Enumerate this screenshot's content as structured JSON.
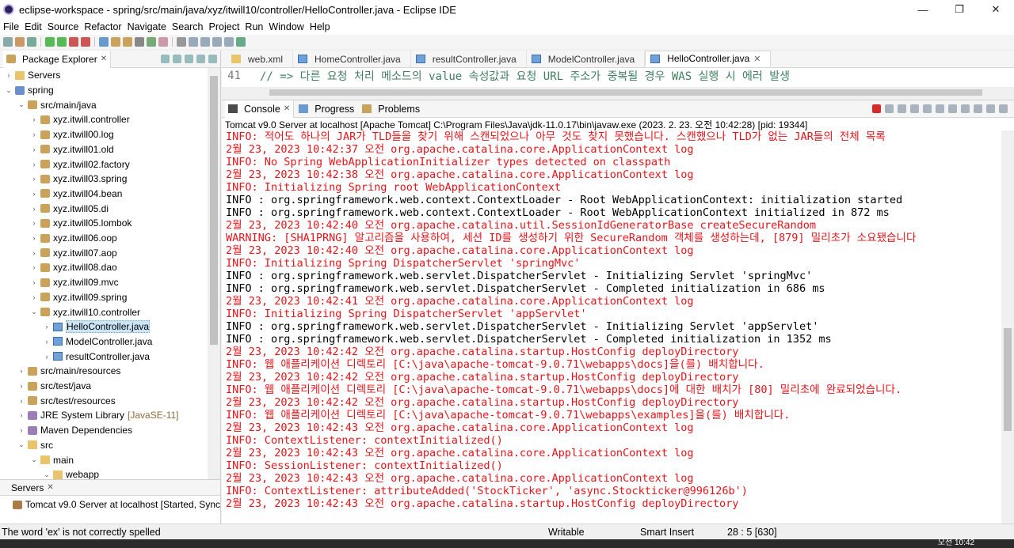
{
  "window": {
    "title": "eclipse-workspace - spring/src/main/java/xyz/itwill10/controller/HelloController.java - Eclipse IDE",
    "minimize": "—",
    "restore": "❐",
    "close": "✕"
  },
  "menu": [
    "File",
    "Edit",
    "Source",
    "Refactor",
    "Navigate",
    "Search",
    "Project",
    "Run",
    "Window",
    "Help"
  ],
  "package_explorer": {
    "tab_label": "Package Explorer",
    "close": "✕",
    "tree": [
      {
        "label": "Servers",
        "icon": "folder-icon",
        "twisty": "›",
        "indent": 0
      },
      {
        "label": "spring",
        "icon": "project-icon",
        "twisty": "⌄",
        "indent": 0
      },
      {
        "label": "src/main/java",
        "icon": "package-folder-icon",
        "twisty": "⌄",
        "indent": 1
      },
      {
        "label": "xyz.itwill.controller",
        "icon": "package-icon",
        "twisty": "›",
        "indent": 2
      },
      {
        "label": "xyz.itwill00.log",
        "icon": "package-icon",
        "twisty": "›",
        "indent": 2
      },
      {
        "label": "xyz.itwill01.old",
        "icon": "package-icon",
        "twisty": "›",
        "indent": 2
      },
      {
        "label": "xyz.itwill02.factory",
        "icon": "package-icon",
        "twisty": "›",
        "indent": 2
      },
      {
        "label": "xyz.itwill03.spring",
        "icon": "package-icon",
        "twisty": "›",
        "indent": 2
      },
      {
        "label": "xyz.itwill04.bean",
        "icon": "package-icon",
        "twisty": "›",
        "indent": 2
      },
      {
        "label": "xyz.itwill05.di",
        "icon": "package-icon",
        "twisty": "›",
        "indent": 2
      },
      {
        "label": "xyz.itwill05.lombok",
        "icon": "package-icon",
        "twisty": "›",
        "indent": 2
      },
      {
        "label": "xyz.itwill06.oop",
        "icon": "package-icon",
        "twisty": "›",
        "indent": 2
      },
      {
        "label": "xyz.itwill07.aop",
        "icon": "package-icon",
        "twisty": "›",
        "indent": 2
      },
      {
        "label": "xyz.itwill08.dao",
        "icon": "package-icon",
        "twisty": "›",
        "indent": 2
      },
      {
        "label": "xyz.itwill09.mvc",
        "icon": "package-icon",
        "twisty": "›",
        "indent": 2
      },
      {
        "label": "xyz.itwill09.spring",
        "icon": "package-icon",
        "twisty": "›",
        "indent": 2
      },
      {
        "label": "xyz.itwill10.controller",
        "icon": "package-icon",
        "twisty": "⌄",
        "indent": 2
      },
      {
        "label": "HelloController.java",
        "icon": "java-file-icon",
        "twisty": "›",
        "indent": 3,
        "selected": true
      },
      {
        "label": "ModelController.java",
        "icon": "java-file-icon",
        "twisty": "›",
        "indent": 3
      },
      {
        "label": "resultController.java",
        "icon": "java-file-icon",
        "twisty": "›",
        "indent": 3
      },
      {
        "label": "src/main/resources",
        "icon": "package-folder-icon",
        "twisty": "›",
        "indent": 1
      },
      {
        "label": "src/test/java",
        "icon": "package-folder-icon",
        "twisty": "›",
        "indent": 1
      },
      {
        "label": "src/test/resources",
        "icon": "package-folder-icon",
        "twisty": "›",
        "indent": 1
      },
      {
        "label": "JRE System Library",
        "suffix": "[JavaSE-11]",
        "icon": "library-icon",
        "twisty": "›",
        "indent": 1
      },
      {
        "label": "Maven Dependencies",
        "icon": "library-icon",
        "twisty": "›",
        "indent": 1
      },
      {
        "label": "src",
        "icon": "folder-icon",
        "twisty": "⌄",
        "indent": 1
      },
      {
        "label": "main",
        "icon": "folder-icon",
        "twisty": "⌄",
        "indent": 2
      },
      {
        "label": "webapp",
        "icon": "folder-icon",
        "twisty": "⌄",
        "indent": 3
      }
    ]
  },
  "servers_view": {
    "tab_label": "Servers",
    "close": "✕",
    "row": "Tomcat v9.0 Server at localhost  [Started, Sync"
  },
  "editor": {
    "tabs": [
      {
        "label": "web.xml",
        "active": false
      },
      {
        "label": "HomeController.java",
        "active": false
      },
      {
        "label": "resultController.java",
        "active": false
      },
      {
        "label": "ModelController.java",
        "active": false
      },
      {
        "label": "HelloController.java",
        "active": true
      }
    ],
    "line_number": "41",
    "line_text": "// => 다른 요청 처리 메소드의 value 속성값과 요청 URL 주소가 중복될 경우 WAS 실행 시 에러 발생"
  },
  "console": {
    "tabs": [
      "Console",
      "Progress",
      "Problems"
    ],
    "info": "Tomcat v9.0 Server at localhost [Apache Tomcat] C:\\Program Files\\Java\\jdk-11.0.17\\bin\\javaw.exe  (2023. 2. 23. 오전 10:42:28) [pid: 19344]",
    "lines": [
      {
        "t": "INFO: 적어도 하나의 JAR가 TLD들을 찾기 위해 스캔되었으나 아무 것도 찾지 못했습니다. 스캔했으나 TLD가 없는 JAR들의 전체 목록",
        "k": "err"
      },
      {
        "t": "2월 23, 2023 10:42:37 오전 org.apache.catalina.core.ApplicationContext log",
        "k": "err"
      },
      {
        "t": "INFO: No Spring WebApplicationInitializer types detected on classpath",
        "k": "err"
      },
      {
        "t": "2월 23, 2023 10:42:38 오전 org.apache.catalina.core.ApplicationContext log",
        "k": "err"
      },
      {
        "t": "INFO: Initializing Spring root WebApplicationContext",
        "k": "err"
      },
      {
        "t": "INFO : org.springframework.web.context.ContextLoader - Root WebApplicationContext: initialization started",
        "k": "out"
      },
      {
        "t": "INFO : org.springframework.web.context.ContextLoader - Root WebApplicationContext initialized in 872 ms",
        "k": "out"
      },
      {
        "t": "2월 23, 2023 10:42:40 오전 org.apache.catalina.util.SessionIdGeneratorBase createSecureRandom",
        "k": "err"
      },
      {
        "t": "WARNING: [SHA1PRNG] 알고리즘을 사용하여, 세션 ID를 생성하기 위한 SecureRandom 객체를 생성하는데, [879] 밀리초가 소요됐습니다",
        "k": "err"
      },
      {
        "t": "2월 23, 2023 10:42:40 오전 org.apache.catalina.core.ApplicationContext log",
        "k": "err"
      },
      {
        "t": "INFO: Initializing Spring DispatcherServlet 'springMvc'",
        "k": "err"
      },
      {
        "t": "INFO : org.springframework.web.servlet.DispatcherServlet - Initializing Servlet 'springMvc'",
        "k": "out"
      },
      {
        "t": "INFO : org.springframework.web.servlet.DispatcherServlet - Completed initialization in 686 ms",
        "k": "out"
      },
      {
        "t": "2월 23, 2023 10:42:41 오전 org.apache.catalina.core.ApplicationContext log",
        "k": "err"
      },
      {
        "t": "INFO: Initializing Spring DispatcherServlet 'appServlet'",
        "k": "err"
      },
      {
        "t": "INFO : org.springframework.web.servlet.DispatcherServlet - Initializing Servlet 'appServlet'",
        "k": "out"
      },
      {
        "t": "INFO : org.springframework.web.servlet.DispatcherServlet - Completed initialization in 1352 ms",
        "k": "out"
      },
      {
        "t": "2월 23, 2023 10:42:42 오전 org.apache.catalina.startup.HostConfig deployDirectory",
        "k": "err"
      },
      {
        "t": "INFO: 웹 애플리케이션 디렉토리 [C:\\java\\apache-tomcat-9.0.71\\webapps\\docs]을(를) 배치합니다.",
        "k": "err"
      },
      {
        "t": "2월 23, 2023 10:42:42 오전 org.apache.catalina.startup.HostConfig deployDirectory",
        "k": "err"
      },
      {
        "t": "INFO: 웹 애플리케이션 디렉토리 [C:\\java\\apache-tomcat-9.0.71\\webapps\\docs]에 대한 배치가 [80] 밀리초에 완료되었습니다.",
        "k": "err"
      },
      {
        "t": "2월 23, 2023 10:42:42 오전 org.apache.catalina.startup.HostConfig deployDirectory",
        "k": "err"
      },
      {
        "t": "INFO: 웹 애플리케이션 디렉토리 [C:\\java\\apache-tomcat-9.0.71\\webapps\\examples]을(를) 배치합니다.",
        "k": "err"
      },
      {
        "t": "2월 23, 2023 10:42:43 오전 org.apache.catalina.core.ApplicationContext log",
        "k": "err"
      },
      {
        "t": "INFO: ContextListener: contextInitialized()",
        "k": "err"
      },
      {
        "t": "2월 23, 2023 10:42:43 오전 org.apache.catalina.core.ApplicationContext log",
        "k": "err"
      },
      {
        "t": "INFO: SessionListener: contextInitialized()",
        "k": "err"
      },
      {
        "t": "2월 23, 2023 10:42:43 오전 org.apache.catalina.core.ApplicationContext log",
        "k": "err"
      },
      {
        "t": "INFO: ContextListener: attributeAdded('StockTicker', 'async.Stockticker@996126b')",
        "k": "err"
      },
      {
        "t": "2월 23, 2023 10:42:43 오전 org.apache.catalina.startup.HostConfig deployDirectory",
        "k": "err"
      }
    ]
  },
  "status": {
    "message": "The word 'ex' is not correctly spelled",
    "mode": "Writable",
    "insert": "Smart Insert",
    "position": "28 : 5 [630]"
  },
  "taskbar": {
    "clock": "오전 10:42"
  },
  "colors": {
    "error_text": "#e8141a",
    "comment_text": "#3f7f5f",
    "selection": "#cce4f7"
  }
}
